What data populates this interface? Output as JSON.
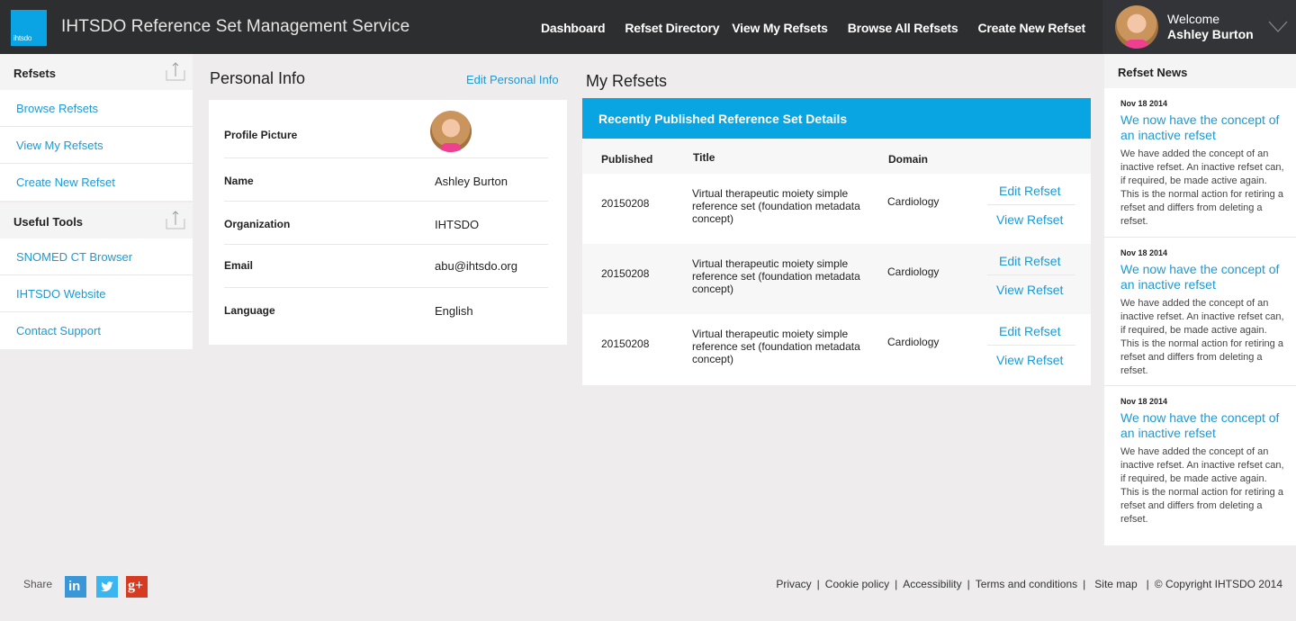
{
  "header": {
    "logo_text": "ihtsdo",
    "app_title": "IHTSDO Reference Set Management Service",
    "nav": [
      {
        "label": "Dashboard"
      },
      {
        "label": "Refset Directory"
      },
      {
        "label": "View My Refsets"
      },
      {
        "label": "Browse All Refsets"
      },
      {
        "label": "Create New Refset"
      }
    ],
    "user": {
      "welcome": "Welcome",
      "name": "Ashley Burton",
      "avatar_icon": "user-avatar",
      "menu_icon": "chevron-down-icon"
    }
  },
  "sidebar": {
    "sections": [
      {
        "title": "Refsets",
        "icon": "collapse-up-icon",
        "items": [
          {
            "label": "Browse Refsets"
          },
          {
            "label": "View My Refsets"
          },
          {
            "label": "Create New Refset"
          }
        ]
      },
      {
        "title": "Useful Tools",
        "icon": "collapse-up-icon",
        "items": [
          {
            "label": "SNOMED CT Browser"
          },
          {
            "label": "IHTSDO Website"
          },
          {
            "label": "Contact Support"
          }
        ]
      }
    ]
  },
  "personal_info": {
    "title": "Personal Info",
    "edit_label": "Edit Personal Info",
    "fields": [
      {
        "label": "Profile Picture",
        "value": ""
      },
      {
        "label": "Name",
        "value": "Ashley Burton"
      },
      {
        "label": "Organization",
        "value": "IHTSDO"
      },
      {
        "label": "Email",
        "value": "abu@ihtsdo.org"
      },
      {
        "label": "Language",
        "value": "English"
      }
    ]
  },
  "my_refsets": {
    "title": "My Refsets",
    "banner": "Recently Published Reference Set Details",
    "columns": [
      "Published",
      "Title",
      "Domain"
    ],
    "rows": [
      {
        "published": "20150208",
        "title": "Virtual therapeutic moiety simple reference set (foundation metadata concept)",
        "domain": "Cardiology",
        "edit_label": "Edit Refset",
        "view_label": "View Refset"
      },
      {
        "published": "20150208",
        "title": "Virtual therapeutic moiety simple reference set (foundation metadata concept)",
        "domain": "Cardiology",
        "edit_label": "Edit Refset",
        "view_label": "View Refset"
      },
      {
        "published": "20150208",
        "title": "Virtual therapeutic moiety simple reference set (foundation metadata concept)",
        "domain": "Cardiology",
        "edit_label": "Edit Refset",
        "view_label": "View Refset"
      }
    ]
  },
  "news": {
    "title": "Refset News",
    "items": [
      {
        "date": "Nov 18 2014",
        "headline": "We now have the concept of an inactive refset",
        "body": "We have added the concept of an inactive refset. An inactive refset can, if required, be made active again. This is the normal action for retiring a refset and differs from deleting a refset."
      },
      {
        "date": "Nov 18 2014",
        "headline": "We now have the concept of an inactive refset",
        "body": "We have added the concept of an inactive refset. An inactive refset can, if required, be made active again. This is the normal action for retiring a refset and differs from deleting a refset."
      },
      {
        "date": "Nov 18 2014",
        "headline": "We now have the concept of an inactive refset",
        "body": "We have added the concept of an inactive refset. An inactive refset can, if required, be made active again. This is the normal action for retiring a refset and differs from deleting a refset."
      }
    ]
  },
  "footer": {
    "share_label": "Share",
    "social": [
      {
        "name": "linkedin",
        "glyph": "in"
      },
      {
        "name": "twitter",
        "glyph": "t"
      },
      {
        "name": "google-plus",
        "glyph": "g+"
      }
    ],
    "links": [
      {
        "label": "Privacy"
      },
      {
        "label": "Cookie policy"
      },
      {
        "label": "Accessibility"
      },
      {
        "label": "Terms and conditions"
      },
      {
        "label": "Site map"
      }
    ],
    "copyright": "© Copyright IHTSDO 2014"
  },
  "colors": {
    "accent": "#08a5e2",
    "link": "#1a9ad6",
    "header_bg": "#2d2e30",
    "page_bg": "#eeecec"
  }
}
